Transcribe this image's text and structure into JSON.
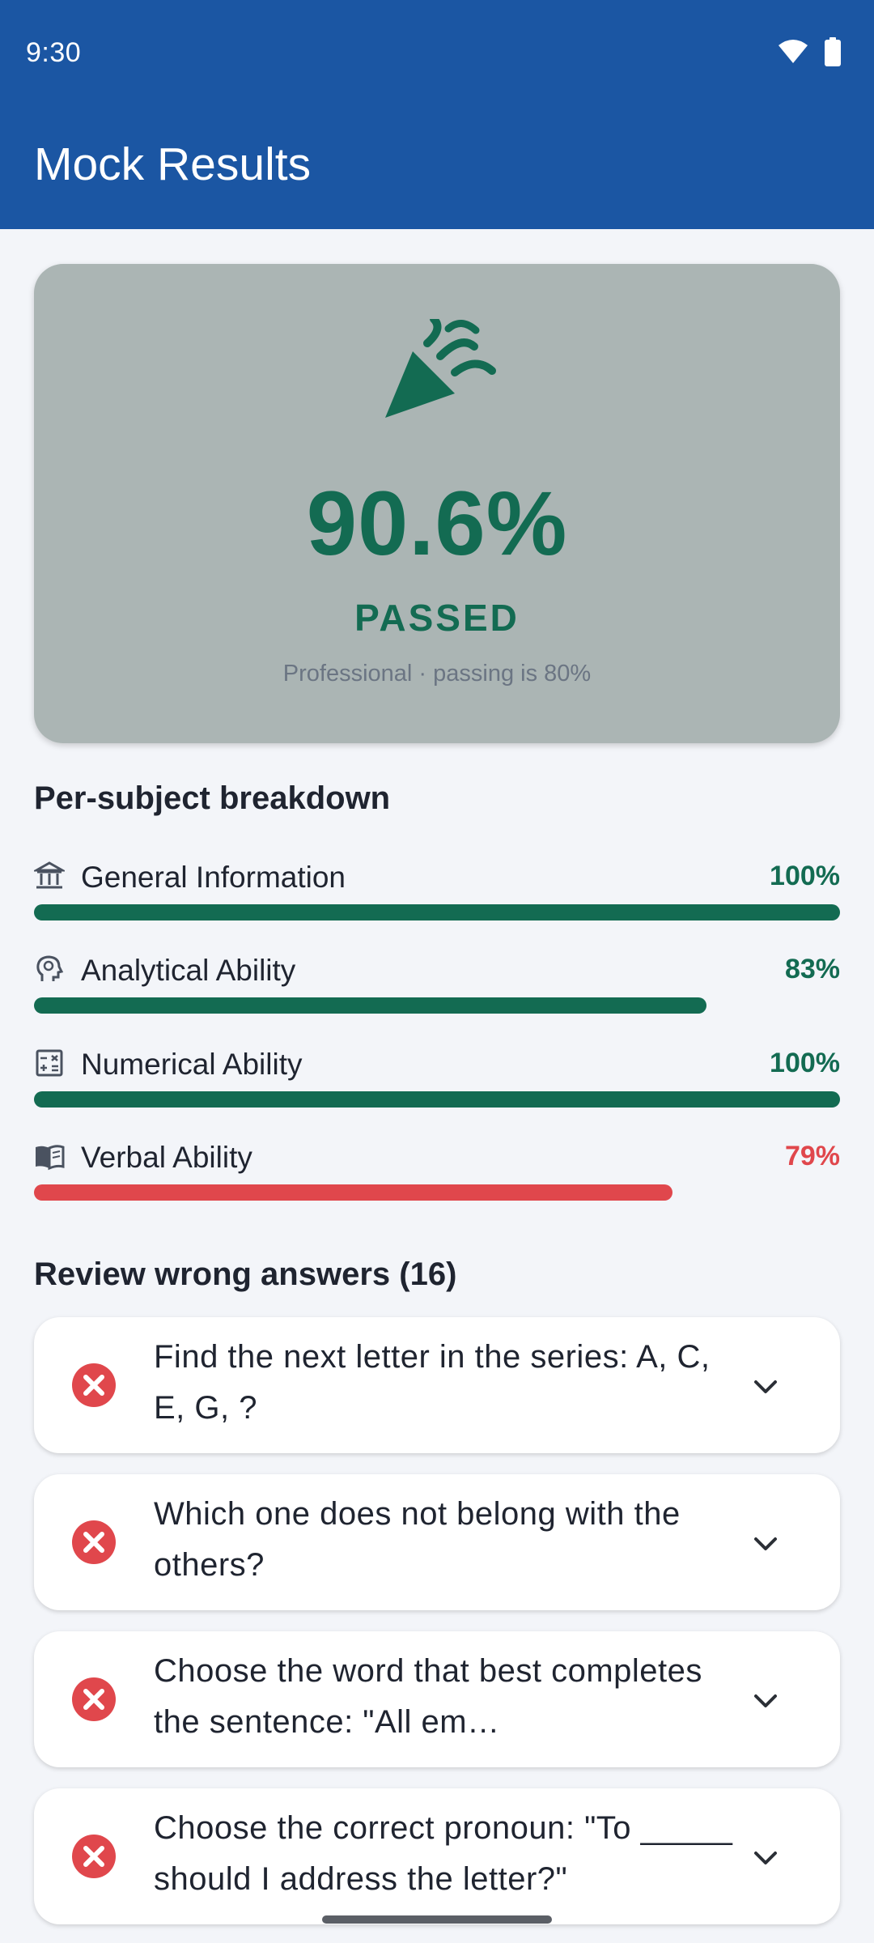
{
  "status_bar": {
    "time": "9:30"
  },
  "app_bar": {
    "title": "Mock Results"
  },
  "score": {
    "value": "90.6%",
    "status": "PASSED",
    "subtitle": "Professional · passing is 80%"
  },
  "breakdown": {
    "title": "Per-subject breakdown",
    "items": [
      {
        "label": "General Information",
        "percent": "100%",
        "value": 100,
        "color": "#136b52",
        "icon": "bank-icon"
      },
      {
        "label": "Analytical Ability",
        "percent": "83%",
        "value": 83,
        "color": "#136b52",
        "icon": "psychology-icon"
      },
      {
        "label": "Numerical Ability",
        "percent": "100%",
        "value": 100,
        "color": "#136b52",
        "icon": "calculator-icon"
      },
      {
        "label": "Verbal Ability",
        "percent": "79%",
        "value": 79,
        "color": "#e0474c",
        "icon": "book-icon"
      }
    ]
  },
  "review": {
    "title": "Review wrong answers (16)",
    "items": [
      {
        "question": "Find the next letter in the series: A, C, E, G, ?"
      },
      {
        "question": "Which one does not belong with the others?"
      },
      {
        "question": "Choose the word that best completes the sentence: \"All em…"
      },
      {
        "question": "Choose the correct pronoun: \"To _____ should I address the letter?\""
      }
    ]
  },
  "colors": {
    "primary": "#1b56a3",
    "pass": "#136b52",
    "fail": "#e0474c"
  }
}
